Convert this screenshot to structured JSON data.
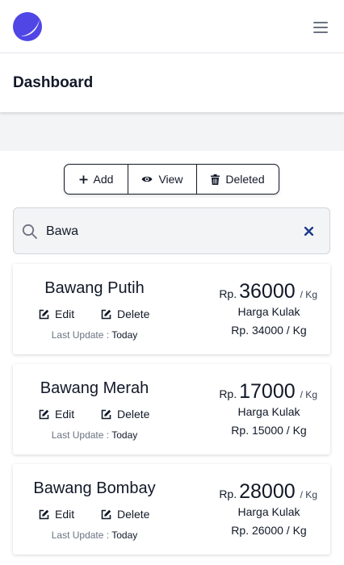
{
  "colors": {
    "brand": "#4f46e5",
    "clear_icon": "#1e3a8a",
    "background_band": "#f3f4f6"
  },
  "header": {
    "title": "Dashboard"
  },
  "toolbar": {
    "add_label": "Add",
    "view_label": "View",
    "deleted_label": "Deleted"
  },
  "search": {
    "value": "Bawa",
    "placeholder": ""
  },
  "labels": {
    "edit": "Edit",
    "delete": "Delete",
    "last_update": "Last Update :",
    "harga_kulak": "Harga Kulak",
    "currency": "Rp.",
    "per_kg": "/ Kg"
  },
  "items": [
    {
      "name": "Bawang Putih",
      "price": "36000",
      "bought_price": "Rp. 34000 / Kg",
      "updated": "Today"
    },
    {
      "name": "Bawang Merah",
      "price": "17000",
      "bought_price": "Rp. 15000 / Kg",
      "updated": "Today"
    },
    {
      "name": "Bawang Bombay",
      "price": "28000",
      "bought_price": "Rp. 26000 / Kg",
      "updated": "Today"
    }
  ]
}
